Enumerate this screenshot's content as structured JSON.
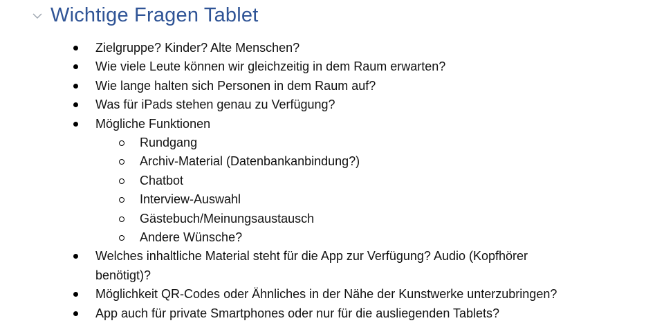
{
  "heading": {
    "title": "Wichtige Fragen Tablet",
    "toggle_icon": "chevron-down-icon",
    "color": "#2f5496"
  },
  "items": [
    {
      "text": "Zielgruppe? Kinder? Alte Menschen?"
    },
    {
      "text": "Wie viele Leute können wir gleichzeitig in dem Raum erwarten?"
    },
    {
      "text": "Wie lange halten sich Personen in dem Raum auf?"
    },
    {
      "text": "Was für iPads stehen genau zu Verfügung?"
    },
    {
      "text": "Mögliche Funktionen"
    },
    {
      "text": "Welches inhaltliche Material steht für die App zur Verfügung? Audio (Kopfhörer benötigt)?"
    },
    {
      "text": "Möglichkeit QR-Codes oder Ähnliches in der Nähe der Kunstwerke unterzubringen?"
    },
    {
      "text": "App auch für private Smartphones oder nur für die ausliegenden Tablets?"
    }
  ],
  "subitems": [
    {
      "text": "Rundgang"
    },
    {
      "text": "Archiv-Material (Datenbankanbindung?)"
    },
    {
      "text": "Chatbot"
    },
    {
      "text": "Interview-Auswahl"
    },
    {
      "text": "Gästebuch/Meinungsaustausch"
    },
    {
      "text": "Andere Wünsche?"
    }
  ]
}
